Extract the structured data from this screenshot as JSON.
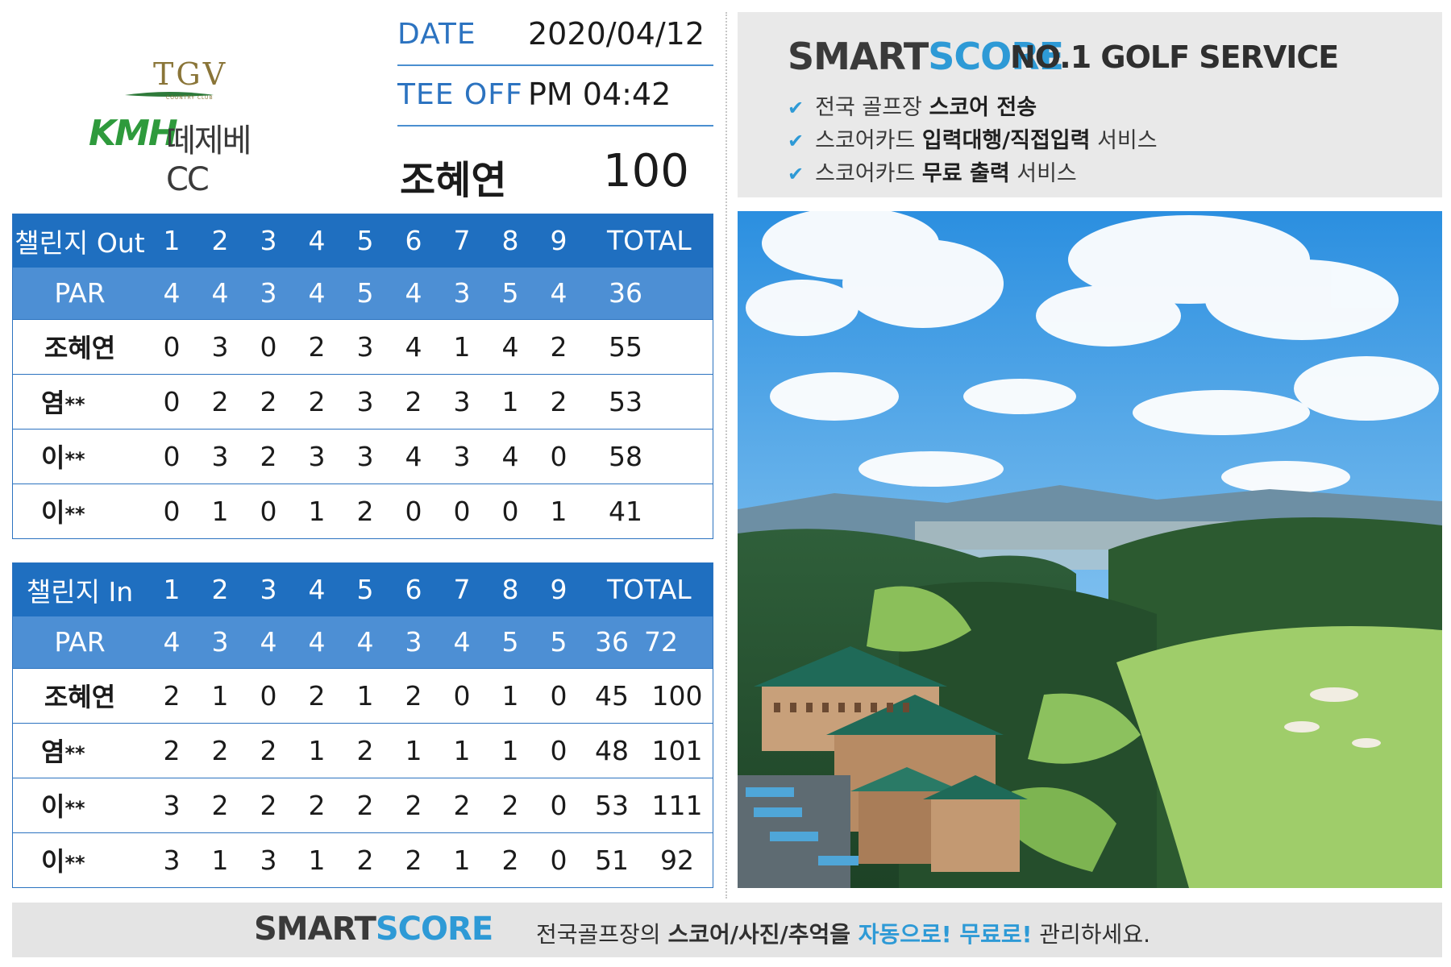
{
  "logo": {
    "tgv": "TGV",
    "country_club": "COUNTRY CLUB",
    "kmh": "KMH",
    "name": "떼제베CC"
  },
  "info": {
    "date_label": "DATE",
    "date_value": "2020/04/12",
    "tee_label": "TEE OFF",
    "tee_value": "PM 04:42"
  },
  "player": {
    "name": "조혜연",
    "score": "100"
  },
  "out_table": {
    "title": "챌린지 Out",
    "holes": [
      "1",
      "2",
      "3",
      "4",
      "5",
      "6",
      "7",
      "8",
      "9"
    ],
    "total_label": "TOTAL",
    "par_label": "PAR",
    "par": [
      "4",
      "4",
      "3",
      "4",
      "5",
      "4",
      "3",
      "5",
      "4"
    ],
    "par_total": "36",
    "players": [
      {
        "name": "조혜연",
        "stars": "",
        "scores": [
          "0",
          "3",
          "0",
          "2",
          "3",
          "4",
          "1",
          "4",
          "2"
        ],
        "total": "55"
      },
      {
        "name": "염",
        "stars": "**",
        "scores": [
          "0",
          "2",
          "2",
          "2",
          "3",
          "2",
          "3",
          "1",
          "2"
        ],
        "total": "53"
      },
      {
        "name": "이",
        "stars": "**",
        "scores": [
          "0",
          "3",
          "2",
          "3",
          "3",
          "4",
          "3",
          "4",
          "0"
        ],
        "total": "58"
      },
      {
        "name": "이",
        "stars": "**",
        "scores": [
          "0",
          "1",
          "0",
          "1",
          "2",
          "0",
          "0",
          "0",
          "1"
        ],
        "total": "41"
      }
    ]
  },
  "in_table": {
    "title": "챌린지 In",
    "holes": [
      "1",
      "2",
      "3",
      "4",
      "5",
      "6",
      "7",
      "8",
      "9"
    ],
    "total_label": "TOTAL",
    "par_label": "PAR",
    "par": [
      "4",
      "3",
      "4",
      "4",
      "4",
      "3",
      "4",
      "5",
      "5"
    ],
    "par_total": "36",
    "par_grand": "72",
    "players": [
      {
        "name": "조혜연",
        "stars": "",
        "scores": [
          "2",
          "1",
          "0",
          "2",
          "1",
          "2",
          "0",
          "1",
          "0"
        ],
        "total": "45",
        "grand": "100"
      },
      {
        "name": "염",
        "stars": "**",
        "scores": [
          "2",
          "2",
          "2",
          "1",
          "2",
          "1",
          "1",
          "1",
          "0"
        ],
        "total": "48",
        "grand": "101"
      },
      {
        "name": "이",
        "stars": "**",
        "scores": [
          "3",
          "2",
          "2",
          "2",
          "2",
          "2",
          "2",
          "2",
          "0"
        ],
        "total": "53",
        "grand": "111"
      },
      {
        "name": "이",
        "stars": "**",
        "scores": [
          "3",
          "1",
          "3",
          "1",
          "2",
          "2",
          "1",
          "2",
          "0"
        ],
        "total": "51",
        "grand": "92"
      }
    ]
  },
  "promo": {
    "brand_a": "SMART",
    "brand_b": "SCORE",
    "tagline": "NO.1 GOLF SERVICE",
    "features": [
      {
        "pre": "전국 골프장 ",
        "bold": "스코어 전송",
        "post": ""
      },
      {
        "pre": "스코어카드 ",
        "bold": "입력대행/직접입력",
        "post": " 서비스"
      },
      {
        "pre": "스코어카드 ",
        "bold": "무료 출력",
        "post": " 서비스"
      }
    ]
  },
  "footer": {
    "brand_a": "SMART",
    "brand_b": "SCORE",
    "slogan_pre": "전국골프장의 ",
    "slogan_bold": "스코어/사진/추억을",
    "slogan_hl": " 자동으로! 무료로!",
    "slogan_post": " 관리하세요."
  },
  "colors": {
    "header_blue": "#1f6fc0",
    "par_blue": "#4d8fd4",
    "accent": "#2e9ad6",
    "logo_green": "#2e9a3c",
    "logo_gold": "#8a7538"
  }
}
